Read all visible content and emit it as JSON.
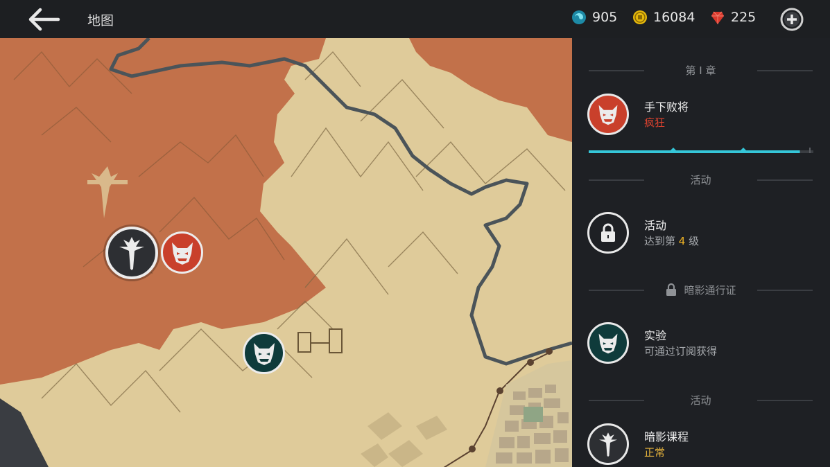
{
  "header": {
    "title": "地图",
    "currencies": [
      {
        "icon": "swirl-orb-icon",
        "value": "905",
        "color": "#27a9c4"
      },
      {
        "icon": "gold-coin-icon",
        "value": "16084",
        "color": "#e5b80b"
      },
      {
        "icon": "red-gem-icon",
        "value": "225",
        "color": "#d9382c"
      }
    ]
  },
  "panel": {
    "sections": [
      {
        "title": "第 I 章"
      },
      {
        "title": "活动"
      },
      {
        "title": "暗影通行证"
      },
      {
        "title": "活动"
      }
    ],
    "entries": [
      {
        "name": "手下败将",
        "sub": "疯狂",
        "icon": "oni-mask-icon",
        "sub_color": "#e0432f"
      },
      {
        "name": "活动",
        "sub_prefix": "达到第 ",
        "sub_level": "4",
        "sub_suffix": " 级",
        "icon": "lock-icon"
      },
      {
        "name": "实验",
        "sub": "可通过订阅获得",
        "icon": "oni-mask-icon"
      },
      {
        "name": "暗影课程",
        "sub": "正常",
        "icon": "shadow-trident-icon",
        "sub_color": "#e7b43c"
      }
    ],
    "chapter_progress": 0.94
  },
  "colors": {
    "accent": "#35c6d8",
    "enemy_red": "#c9402b",
    "teal": "#0f3b3b",
    "level_yellow": "#f0b424"
  }
}
